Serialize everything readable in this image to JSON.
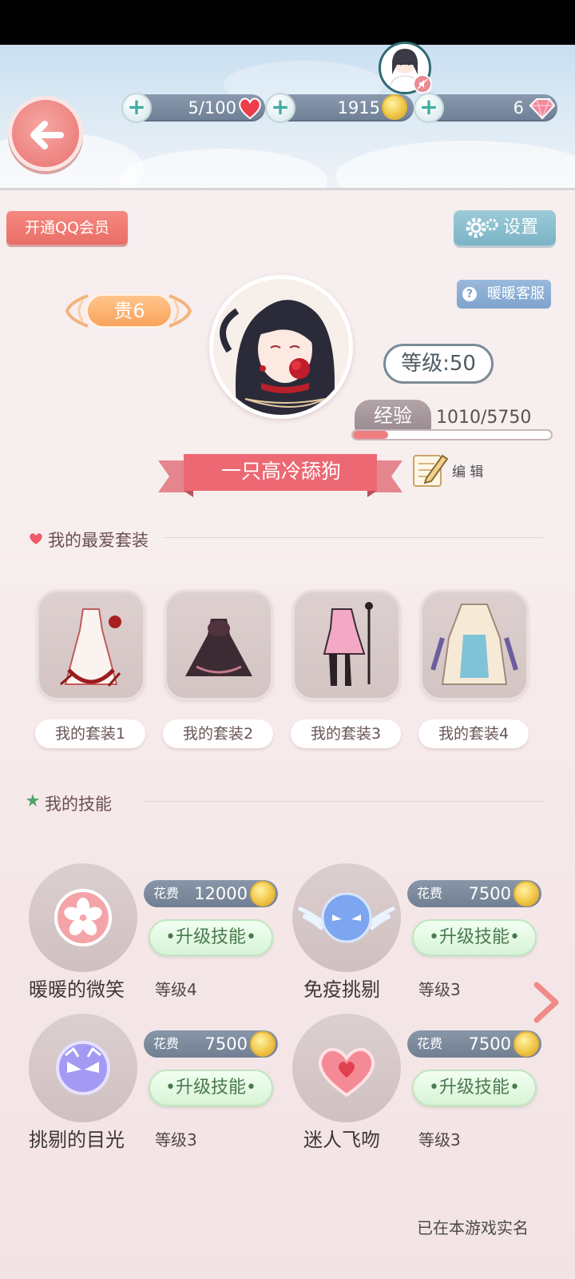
{
  "resources": {
    "stamina": "5/100",
    "gold": "1915",
    "diamonds": "6"
  },
  "buttons": {
    "qq_vip": "开通QQ会员",
    "settings": "设置",
    "customer_service": "暖暖客服"
  },
  "profile": {
    "vip_level": "贵6",
    "level": "等级:50",
    "exp_label": "经验",
    "exp_value": "1010/5750",
    "exp_progress": 0.176,
    "nickname": "一只高冷舔狗",
    "edit_label": "编 辑"
  },
  "favorites": {
    "title": "我的最爱套装",
    "suits": [
      {
        "label": "我的套装1"
      },
      {
        "label": "我的套装2"
      },
      {
        "label": "我的套装3"
      },
      {
        "label": "我的套装4"
      }
    ]
  },
  "skills": {
    "title": "我的技能",
    "cost_label": "花费",
    "upgrade_label": "•升级技能•",
    "items": [
      {
        "name": "暖暖的微笑",
        "level": "等级4",
        "cost": "12000",
        "icon": "flower-icon"
      },
      {
        "name": "免疫挑剔",
        "level": "等级3",
        "cost": "7500",
        "icon": "winged-mask-icon"
      },
      {
        "name": "挑剔的目光",
        "level": "等级3",
        "cost": "7500",
        "icon": "purple-mask-icon"
      },
      {
        "name": "迷人飞吻",
        "level": "等级3",
        "cost": "7500",
        "icon": "heart-icon"
      }
    ]
  },
  "footer": {
    "realname_status": "已在本游戏实名"
  },
  "colors": {
    "accent_red": "#ea6e68",
    "settings_blue": "#7bb3c5",
    "upgrade_green": "#d7f3d6",
    "resource_bar": "#727f92"
  }
}
